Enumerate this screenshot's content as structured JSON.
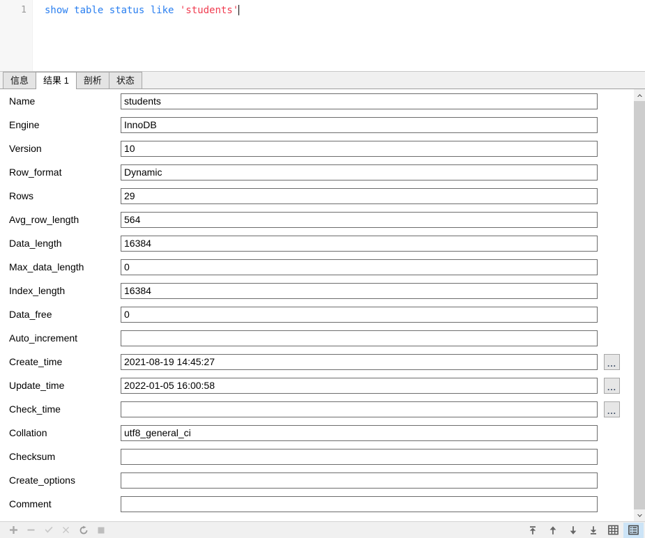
{
  "editor": {
    "line_number": "1",
    "sql_tokens": [
      {
        "text": "show table status like ",
        "type": "keyword"
      },
      {
        "text": "'students'",
        "type": "string"
      }
    ],
    "sql_full": "show table status like 'students'",
    "keyword_color": "#2a7ff0",
    "string_color": "#f03c50"
  },
  "tabs": [
    {
      "label": "信息",
      "active": false,
      "name": "tab-info"
    },
    {
      "label": "结果 1",
      "active": true,
      "name": "tab-result-1"
    },
    {
      "label": "剖析",
      "active": false,
      "name": "tab-profile"
    },
    {
      "label": "状态",
      "active": false,
      "name": "tab-status"
    }
  ],
  "form": {
    "fields": [
      {
        "label": "Name",
        "value": "students",
        "has_button": false
      },
      {
        "label": "Engine",
        "value": "InnoDB",
        "has_button": false
      },
      {
        "label": "Version",
        "value": "10",
        "has_button": false
      },
      {
        "label": "Row_format",
        "value": "Dynamic",
        "has_button": false
      },
      {
        "label": "Rows",
        "value": "29",
        "has_button": false
      },
      {
        "label": "Avg_row_length",
        "value": "564",
        "has_button": false
      },
      {
        "label": "Data_length",
        "value": "16384",
        "has_button": false
      },
      {
        "label": "Max_data_length",
        "value": "0",
        "has_button": false
      },
      {
        "label": "Index_length",
        "value": "16384",
        "has_button": false
      },
      {
        "label": "Data_free",
        "value": "0",
        "has_button": false
      },
      {
        "label": "Auto_increment",
        "value": "",
        "has_button": false
      },
      {
        "label": "Create_time",
        "value": "2021-08-19 14:45:27",
        "has_button": true
      },
      {
        "label": "Update_time",
        "value": "2022-01-05 16:00:58",
        "has_button": true
      },
      {
        "label": "Check_time",
        "value": "",
        "has_button": true
      },
      {
        "label": "Collation",
        "value": "utf8_general_ci",
        "has_button": false
      },
      {
        "label": "Checksum",
        "value": "",
        "has_button": false
      },
      {
        "label": "Create_options",
        "value": "",
        "has_button": false
      },
      {
        "label": "Comment",
        "value": "",
        "has_button": false
      }
    ],
    "ellipsis_label": "..."
  },
  "scrollbar": {
    "up_arrow_icon": "chevron-up-icon",
    "down_arrow_icon": "chevron-down-icon",
    "thumb_top_pct": 0,
    "thumb_height_pct": 100
  },
  "toolbar": {
    "left_buttons": [
      {
        "name": "add-record-button",
        "icon": "plus-icon",
        "enabled": true
      },
      {
        "name": "delete-record-button",
        "icon": "minus-icon",
        "enabled": false
      },
      {
        "name": "apply-change-button",
        "icon": "check-icon",
        "enabled": false
      },
      {
        "name": "cancel-change-button",
        "icon": "cross-icon",
        "enabled": false
      },
      {
        "name": "refresh-button",
        "icon": "refresh-icon",
        "enabled": true
      },
      {
        "name": "stop-button",
        "icon": "stop-icon",
        "enabled": true
      }
    ],
    "right_buttons": [
      {
        "name": "first-record-button",
        "icon": "first-record-icon",
        "active": false
      },
      {
        "name": "prev-record-button",
        "icon": "arrow-up-icon",
        "active": false
      },
      {
        "name": "next-record-button",
        "icon": "arrow-down-icon",
        "active": false
      },
      {
        "name": "last-record-button",
        "icon": "last-record-icon",
        "active": false
      },
      {
        "name": "grid-view-button",
        "icon": "grid-icon",
        "active": false
      },
      {
        "name": "form-view-button",
        "icon": "form-icon",
        "active": true
      }
    ],
    "active_highlight_color": "#cce4f7"
  }
}
